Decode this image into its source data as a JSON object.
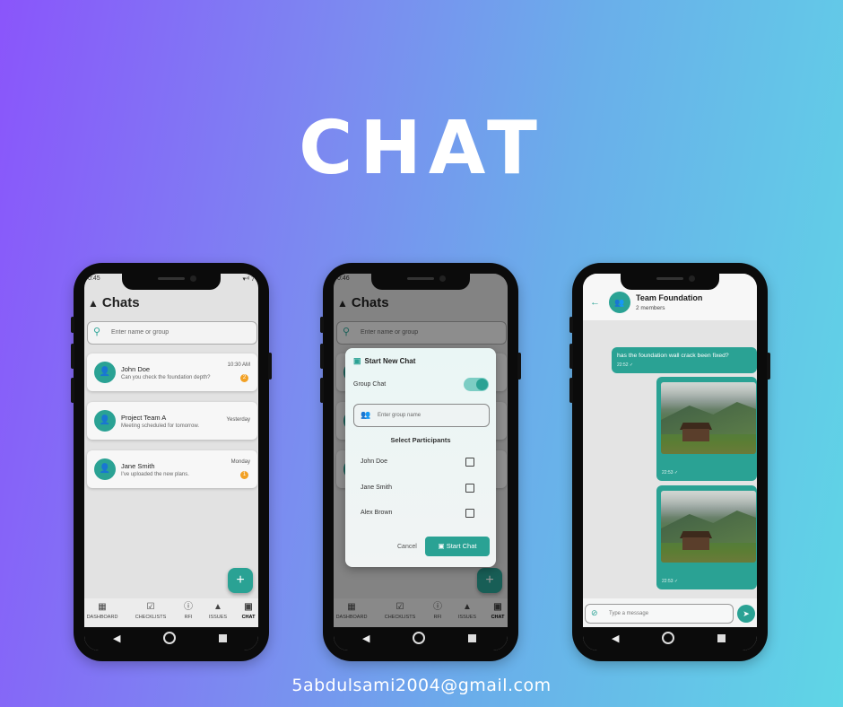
{
  "headline": "CHAT",
  "email": "5abdulsami2004@gmail.com",
  "colors": {
    "accent": "#2aa294",
    "badge": "#f2a125"
  },
  "phone1": {
    "status_time": "0:45",
    "status_right": "▾⁴ᴵ 7",
    "title": "Chats",
    "search_placeholder": "Enter name or group",
    "chats": [
      {
        "name": "John Doe",
        "preview": "Can you check the foundation depth?",
        "time": "10:30 AM",
        "badge": "2"
      },
      {
        "name": "Project Team A",
        "preview": "Meeting scheduled for tomorrow.",
        "time": "Yesterday",
        "badge": ""
      },
      {
        "name": "Jane Smith",
        "preview": "I've uploaded the new plans.",
        "time": "Monday",
        "badge": "1"
      }
    ],
    "nav": [
      "DASHBOARD",
      "CHECKLISTS",
      "RFI",
      "ISSUES",
      "CHAT"
    ]
  },
  "phone2": {
    "status_time": "0:46",
    "title": "Chats",
    "search_placeholder": "Enter name or group",
    "dialog": {
      "title": "Start New Chat",
      "group_label": "Group Chat",
      "group_on": true,
      "group_name_placeholder": "Enter group name",
      "section": "Select Participants",
      "participants": [
        "John Doe",
        "Jane Smith",
        "Alex Brown"
      ],
      "cancel": "Cancel",
      "start": "Start Chat"
    },
    "nav": [
      "DASHBOARD",
      "CHECKLISTS",
      "RFI",
      "ISSUES",
      "CHAT"
    ]
  },
  "phone3": {
    "title": "Team Foundation",
    "subtitle": "2 members",
    "messages": [
      {
        "text": "has the foundation wall crack been fixed?",
        "time": "22:52"
      },
      {
        "time": "22:53"
      },
      {
        "time": "22:53"
      }
    ],
    "input_placeholder": "Type a message"
  }
}
